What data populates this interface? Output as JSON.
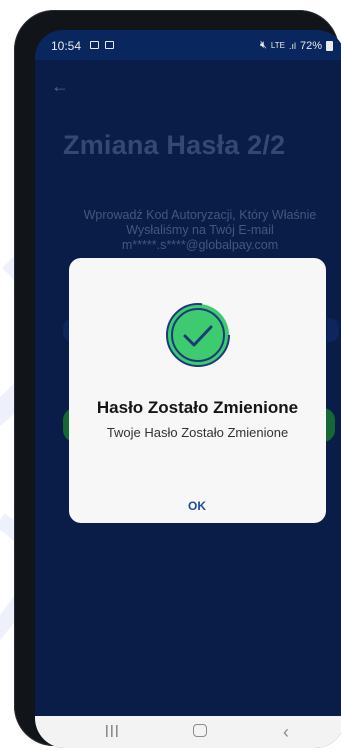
{
  "status_bar": {
    "time": "10:54",
    "battery": "72%",
    "icons": [
      "gallery-icon",
      "mail-icon",
      "mute-icon",
      "lte-icon",
      "signal-icon",
      "battery-icon"
    ]
  },
  "page": {
    "title": "Zmiana Hasła 2/2",
    "instruction_line1": "Wprowadź Kod Autoryzacji, Który Właśnie",
    "instruction_line2": "Wysłaliśmy na Twój E-mail",
    "email": "m*****.s****@globalpay.com"
  },
  "dialog": {
    "title": "Hasło Zostało Zmienione",
    "message": "Twoje Hasło Zostało Zmienione",
    "ok_label": "OK"
  },
  "colors": {
    "screen_background": "#0b1f4f",
    "success_green": "#3ecb6f",
    "ok_text": "#1c4c9e"
  }
}
